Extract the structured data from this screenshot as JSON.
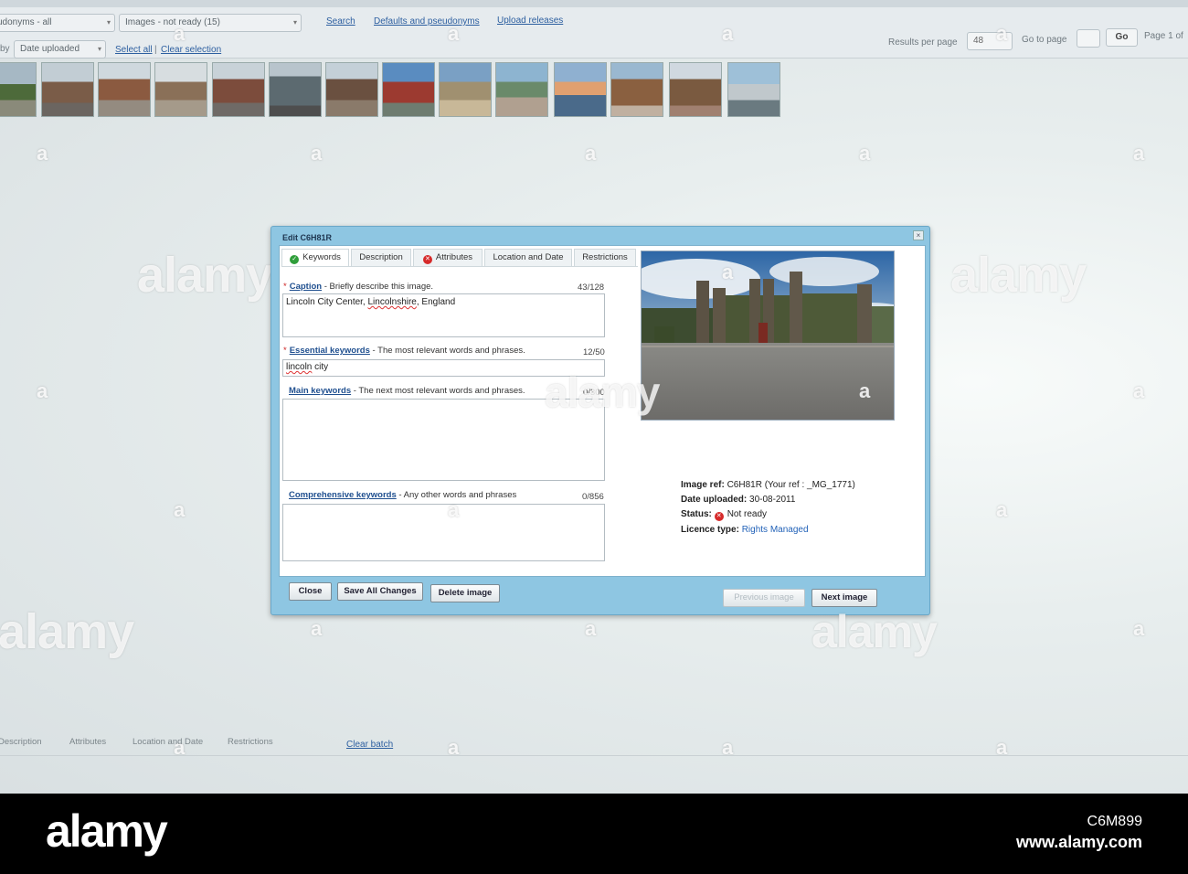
{
  "topbar": {
    "filter_select": "udonyms - all",
    "status_select": "Images - not ready (15)",
    "links": [
      "Search",
      "Defaults and pseudonyms",
      "Upload releases"
    ],
    "sort_prefix": "by",
    "sort_select": "Date uploaded",
    "select_all": "Select all",
    "clear_selection": "Clear selection",
    "results_per_page_label": "Results per page",
    "results_per_page_value": "48",
    "go_to_page_label": "Go to page",
    "go_button": "Go",
    "page_of": "Page 1 of"
  },
  "dialog": {
    "title": "Edit C6H81R",
    "close_glyph": "×",
    "tabs": [
      {
        "label": "Keywords",
        "status": "ok"
      },
      {
        "label": "Description",
        "status": "none"
      },
      {
        "label": "Attributes",
        "status": "error"
      },
      {
        "label": "Location and Date",
        "status": "none"
      },
      {
        "label": "Restrictions",
        "status": "none"
      }
    ],
    "caption": {
      "label": "Caption",
      "hint": " - Briefly describe this image.",
      "count": "43/128",
      "value_before": "Lincoln City Center, ",
      "value_misspelled": "Lincolnshire",
      "value_after": ", England"
    },
    "essential": {
      "label": "Essential keywords",
      "hint": " - The most relevant words and phrases.",
      "count": "12/50",
      "value_misspelled": "lincoln",
      "value_after": " city"
    },
    "main": {
      "label": "Main keywords",
      "hint": " - The next most relevant words and phrases.",
      "count": "0/300",
      "value": ""
    },
    "comprehensive": {
      "label": "Comprehensive keywords",
      "hint": " - Any other words and phrases",
      "count": "0/856",
      "value": ""
    },
    "info": {
      "image_ref_label": "Image ref:",
      "image_ref_value": " C6H81R (Your ref : _MG_1771)",
      "date_label": "Date uploaded:",
      "date_value": " 30-08-2011",
      "status_label": "Status:",
      "status_value": "Not ready",
      "licence_label": "Licence type:",
      "licence_value": " Rights Managed"
    },
    "buttons": {
      "close": "Close",
      "save": "Save All Changes",
      "delete": "Delete image",
      "previous": "Previous image",
      "next": "Next image"
    }
  },
  "bottom_tabs": [
    "Description",
    "Attributes",
    "Location and Date",
    "Restrictions"
  ],
  "clear_batch": "Clear batch",
  "watermark": "alamy",
  "watermark_mark": "a",
  "footer": {
    "logo": "alamy",
    "image_id": "C6M899",
    "url": "www.alamy.com"
  },
  "colors": {
    "dialog_frame": "#8ec6e2",
    "link": "#2d5fa0",
    "error": "#d62a2a",
    "ok": "#2f9e3a"
  }
}
